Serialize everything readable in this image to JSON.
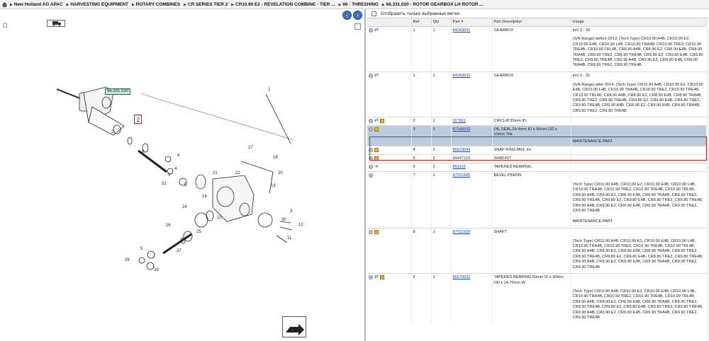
{
  "breadcrumb": [
    "New Holland AG APAC",
    "HARVESTING EQUIPMENT",
    "ROTARY COMBINES",
    "CR SERIES TIER 2",
    "CR10.90 E2 - REVELATION COMBINE - TIER ...",
    "66 - THRESHING",
    "66.331.020 - ROTOR GEARBOX LH ROTOR ..."
  ],
  "filter_label": "Отобразить только выбранные метки",
  "columns": [
    "",
    "Ref",
    "Qty",
    "Part #",
    "Part Description",
    "Usage"
  ],
  "diagram": {
    "callout": "66.331.030",
    "hotspot": "3",
    "labels": [
      "1",
      "2",
      "3",
      "4",
      "5",
      "6",
      "7",
      "8",
      "11",
      "12",
      "16",
      "17",
      "18",
      "19",
      "20",
      "21",
      "22",
      "23",
      "24",
      "25",
      "26",
      "27",
      "28",
      "29",
      "30",
      "31",
      "5",
      "6",
      "4",
      "5"
    ]
  },
  "rows": [
    {
      "ref": "1",
      "qty": "1",
      "part": "84343531",
      "desc": "GEARBOX",
      "usage": "Incl 2 - 30",
      "icons": [
        "circ",
        "swap"
      ],
      "extra": [
        "(S/N Range) before 2013; (Tech Type) CR10.90 A4B, CR10.90 E2, CR10.90 E4B, CR10.90 L4B, CR10.90 TRA4B, CR10.90 TRE2, CR10.90 TRE4B, CR10.90 TRL4B, CR8.90 A4B, CR8.90 E2, CR8.90 E4B, CR8.90 TRA4B, CR8.90 TRE2, CR8.90 TRE4B, CR9.80 E2, CR9.80 E4B, CR9.80 TRE2, CR9.80 TRE4B, CR9.90 A4B, CR9.90 E2, CR9.90 E4B, CR9.90 TRA4B, CR9.90 TRE2, CR9.90 TRE4B"
      ]
    },
    {
      "ref": "1",
      "qty": "1",
      "part": "84343531",
      "desc": "GEARBOX",
      "usage": "Incl 2 - 31",
      "icons": [
        "circ",
        "swap"
      ],
      "extra": [
        "(S/N Range) after 2014; (Tech Type) CR10.90 A4B, CR10.90 E2, CR10.90 E4B, CR10.90 L4B, CR10.90 TRA4B, CR10.90 TRE2, CR10.90 TRE4B, CR10.90 TRL4B, CR8.90 A4B, CR8.90 E2, CR8.90 E4B, CR8.90 TRA4B, CR8.90 TRE2, CR8.90 TRE4B, CR9.80 E2, CR9.80 E4B, CR9.80 TRE2, CR9.80 TRE4B, CR9.90 A4B, CR9.90 E2, CR9.90 E4B, CR9.90 TRA4B, CR9.90 TRE2, CR9.90 TRE4B"
      ]
    },
    {
      "ref": "2",
      "qty": "1",
      "part": "327811",
      "desc": "CIRCLIP,55mm ID",
      "usage": "",
      "icons": [
        "circ",
        "swap",
        "box"
      ],
      "extra": []
    },
    {
      "ref": "3",
      "qty": "1",
      "part": "87540643",
      "desc": "OIL SEAL,54.4mm ID x 90mm OD x 10mm Thk",
      "usage": "",
      "icons": [
        "circ",
        "box"
      ],
      "extra": [
        "MAINTENANCE PART"
      ],
      "selected": true
    },
    {
      "ref": "4",
      "qty": "2",
      "part": "86623594",
      "desc": "SNAP RING,M93, Int",
      "usage": "",
      "icons": [
        "circ",
        "box"
      ],
      "extra": []
    },
    {
      "ref": "5",
      "qty": "2",
      "part": "84447163",
      "desc": "SHIM KIT",
      "usage": "",
      "icons": [
        "circ",
        "box"
      ],
      "extra": []
    },
    {
      "ref": "6",
      "qty": "2",
      "part": "853116",
      "desc": "TAPERED BEARING",
      "usage": "",
      "icons": [
        "circ",
        "arrowg"
      ],
      "extra": []
    },
    {
      "ref": "7",
      "qty": "1",
      "part": "87011645",
      "desc": "BEVEL PINION",
      "usage": "",
      "icons": [
        "circ"
      ],
      "extra": [
        "(Tech Type) CR10.90 A4B, CR10.90 E2, CR10.90 E4B, CR10.90 L4B, CR10.90 TRA4B, CR10.90 TRE2, CR10.90 TRE4B, CR10.90 TRL4B, CR8.90 A4B, CR8.90 E2, CR8.90 E4B, CR8.90 TRA4B, CR8.90 TRE2, CR8.90 TRE4B, CR9.80 E2, CR9.80 E4B, CR9.80 TRE2, CR9.80 TRE4B, CR9.90 A4B, CR9.90 E2, CR9.90 E4B, CR9.90 TRA4B, CR9.90 TRE2, CR9.90 TRE4B",
        "MAINTENANCE PART"
      ]
    },
    {
      "ref": "8",
      "qty": "1",
      "part": "87011629",
      "desc": "SHAFT",
      "usage": "",
      "icons": [
        "circ",
        "box"
      ],
      "extra": [
        "(Tech Type) CR10.90 A4B, CR10.90 E2, CR10.90 E4B, CR10.90 L4B, CR10.90 TRA4B, CR10.90 TRE2, CR10.90 TRE4B, CR10.90 TRL4B, CR8.90 A4B, CR8.90 E2, CR8.90 E4B, CR8.90 TRA4B, CR8.90 TRE2, CR8.90 TRE4B, CR9.80 E2, CR9.80 E4B, CR9.80 TRE2, CR9.80 TRE4B, CR9.90 A4B, CR9.90 E2, CR9.90 E4B, CR9.90 TRA4B, CR9.90 TRE2, CR9.90 TRE4B"
      ]
    },
    {
      "ref": "9",
      "qty": "1",
      "part": "86570632",
      "desc": "TAPERED BEARING,50mm ID x 90mm OD x 24.75mm W",
      "usage": "",
      "icons": [
        "circ",
        "swap",
        "box"
      ],
      "extra": [
        "(Tech Type) CR10.90 A4B, CR10.90 E2, CR10.90 E4B, CR10.90 L4B, CR10.90 TRA4B, CR10.90 TRE2, CR10.90 TRE4B, CR10.90 TRL4B, CR8.90 A4B, CR8.90 E2, CR8.90 E4B, CR8.90 TRA4B, CR8.90 TRE2, CR8.90 TRE4B, CR9.80 E2, CR9.80 E4B, CR9.80 TRE2, CR9.80 TRE4B, CR9.90 A4B, CR9.90 E2, CR9.90 E4B, CR9.90 TRA4B, CR9.90 TRE2, CR9.90 TRE4B"
      ]
    }
  ]
}
